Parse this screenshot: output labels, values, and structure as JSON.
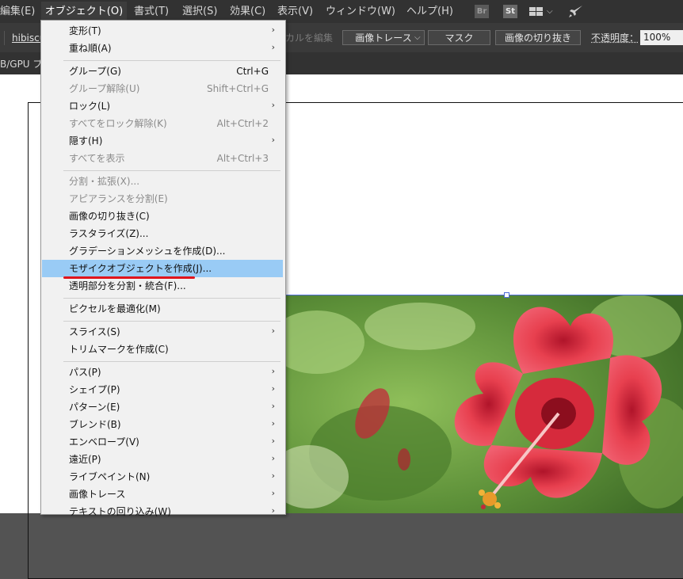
{
  "menubar": {
    "items": [
      "編集(E)",
      "オブジェクト(O)",
      "書式(T)",
      "選択(S)",
      "効果(C)",
      "表示(V)",
      "ウィンドウ(W)",
      "ヘルプ(H)"
    ],
    "tools": {
      "br": "Br",
      "st": "St"
    }
  },
  "control_bar": {
    "object_name": "hibiscu",
    "edit_label": "カルを編集",
    "image_trace": "画像トレース",
    "mask": "マスク",
    "crop": "画像の切り抜き",
    "opacity_label": "不透明度：",
    "opacity_value": "100%"
  },
  "tab": {
    "label": "B/GPU プ"
  },
  "object_menu": {
    "items": [
      {
        "label": "変形(T)",
        "shortcut": "",
        "submenu": true,
        "disabled": false
      },
      {
        "label": "重ね順(A)",
        "shortcut": "",
        "submenu": true,
        "disabled": false
      },
      {
        "label": "グループ(G)",
        "shortcut": "Ctrl+G",
        "submenu": false,
        "disabled": false
      },
      {
        "label": "グループ解除(U)",
        "shortcut": "Shift+Ctrl+G",
        "submenu": false,
        "disabled": true
      },
      {
        "label": "ロック(L)",
        "shortcut": "",
        "submenu": true,
        "disabled": false
      },
      {
        "label": "すべてをロック解除(K)",
        "shortcut": "Alt+Ctrl+2",
        "submenu": false,
        "disabled": true
      },
      {
        "label": "隠す(H)",
        "shortcut": "",
        "submenu": true,
        "disabled": false
      },
      {
        "label": "すべてを表示",
        "shortcut": "Alt+Ctrl+3",
        "submenu": false,
        "disabled": true
      },
      {
        "label": "分割・拡張(X)...",
        "shortcut": "",
        "submenu": false,
        "disabled": true
      },
      {
        "label": "アピアランスを分割(E)",
        "shortcut": "",
        "submenu": false,
        "disabled": true
      },
      {
        "label": "画像の切り抜き(C)",
        "shortcut": "",
        "submenu": false,
        "disabled": false
      },
      {
        "label": "ラスタライズ(Z)...",
        "shortcut": "",
        "submenu": false,
        "disabled": false
      },
      {
        "label": "グラデーションメッシュを作成(D)...",
        "shortcut": "",
        "submenu": false,
        "disabled": false
      },
      {
        "label": "モザイクオブジェクトを作成(J)...",
        "shortcut": "",
        "submenu": false,
        "disabled": false,
        "highlighted": true
      },
      {
        "label": "透明部分を分割・統合(F)...",
        "shortcut": "",
        "submenu": false,
        "disabled": false
      },
      {
        "label": "ピクセルを最適化(M)",
        "shortcut": "",
        "submenu": false,
        "disabled": false
      },
      {
        "label": "スライス(S)",
        "shortcut": "",
        "submenu": true,
        "disabled": false
      },
      {
        "label": "トリムマークを作成(C)",
        "shortcut": "",
        "submenu": false,
        "disabled": false
      },
      {
        "label": "パス(P)",
        "shortcut": "",
        "submenu": true,
        "disabled": false
      },
      {
        "label": "シェイプ(P)",
        "shortcut": "",
        "submenu": true,
        "disabled": false
      },
      {
        "label": "パターン(E)",
        "shortcut": "",
        "submenu": true,
        "disabled": false
      },
      {
        "label": "ブレンド(B)",
        "shortcut": "",
        "submenu": true,
        "disabled": false
      },
      {
        "label": "エンベロープ(V)",
        "shortcut": "",
        "submenu": true,
        "disabled": false
      },
      {
        "label": "遠近(P)",
        "shortcut": "",
        "submenu": true,
        "disabled": false
      },
      {
        "label": "ライブペイント(N)",
        "shortcut": "",
        "submenu": true,
        "disabled": false
      },
      {
        "label": "画像トレース",
        "shortcut": "",
        "submenu": true,
        "disabled": false
      },
      {
        "label": "テキストの回り込み(W)",
        "shortcut": "",
        "submenu": true,
        "disabled": false
      }
    ]
  },
  "colors": {
    "menubar_bg": "#323232",
    "menu_bg": "#f1f1f1",
    "highlight": "#99cbf5",
    "annotation_red": "#e0141c"
  }
}
